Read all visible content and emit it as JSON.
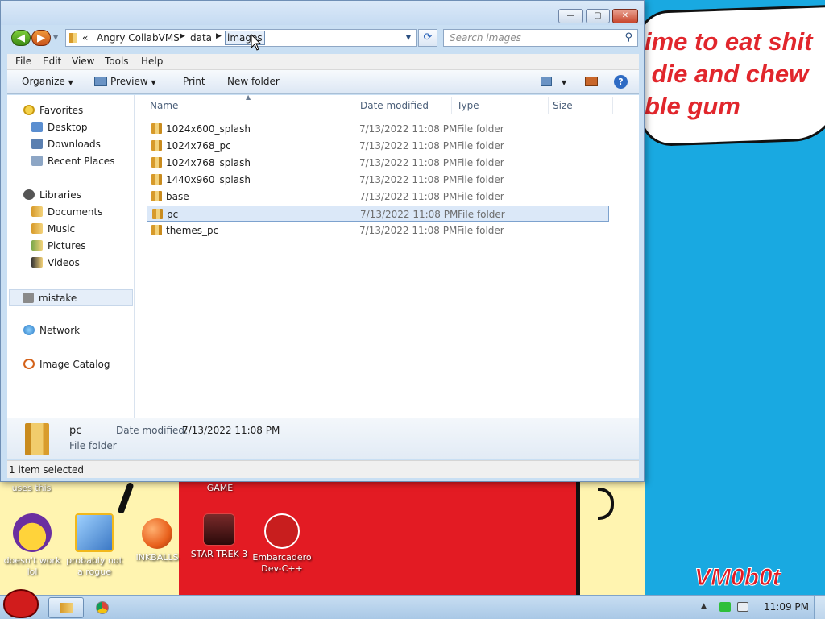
{
  "explorer": {
    "window_buttons": {
      "minimize": "—",
      "maximize": "▢",
      "close": "✕"
    },
    "breadcrumb": [
      "«",
      "Angry CollabVMS",
      "data",
      "images"
    ],
    "search_placeholder": "Search images",
    "menu": [
      "File",
      "Edit",
      "View",
      "Tools",
      "Help"
    ],
    "commands": {
      "organize": "Organize",
      "preview": "Preview",
      "print": "Print",
      "new_folder": "New folder"
    },
    "nav": {
      "favorites": "Favorites",
      "favorites_items": [
        "Desktop",
        "Downloads",
        "Recent Places"
      ],
      "libraries": "Libraries",
      "libraries_items": [
        "Documents",
        "Music",
        "Pictures",
        "Videos"
      ],
      "mistake": "mistake",
      "network": "Network",
      "image_catalog": "Image Catalog"
    },
    "columns": [
      "Name",
      "Date modified",
      "Type",
      "Size"
    ],
    "files": [
      {
        "name": "1024x600_splash",
        "date": "7/13/2022 11:08 PM",
        "type": "File folder"
      },
      {
        "name": "1024x768_pc",
        "date": "7/13/2022 11:08 PM",
        "type": "File folder"
      },
      {
        "name": "1024x768_splash",
        "date": "7/13/2022 11:08 PM",
        "type": "File folder"
      },
      {
        "name": "1440x960_splash",
        "date": "7/13/2022 11:08 PM",
        "type": "File folder"
      },
      {
        "name": "base",
        "date": "7/13/2022 11:08 PM",
        "type": "File folder"
      },
      {
        "name": "pc",
        "date": "7/13/2022 11:08 PM",
        "type": "File folder"
      },
      {
        "name": "themes_pc",
        "date": "7/13/2022 11:08 PM",
        "type": "File folder"
      }
    ],
    "selected_file": "pc",
    "details": {
      "name": "pc",
      "type": "File folder",
      "modified_label": "Date modified:",
      "modified": "7/13/2022 11:08 PM"
    },
    "status": "1 item selected"
  },
  "desktop": {
    "banner_text": "ime to eat shit\n die and chew\nble gum",
    "corner_tag": "VM0b0t",
    "top_labels": [
      "uses this",
      "GAME"
    ],
    "icons": [
      {
        "label": "doesn't work lol",
        "icon": "yahoo-messenger-icon",
        "color": "#6b2fa0"
      },
      {
        "label": "probably not a rogue",
        "icon": "gears-monitor-icon",
        "color": "#f2b81b"
      },
      {
        "label": "INKBALLS",
        "icon": "inkball-icon",
        "color": "#e8601c"
      },
      {
        "label": "STAR TREK 3",
        "icon": "star-wars-game-icon",
        "color": "#5a1e1e"
      },
      {
        "label": "Embarcadero Dev-C++",
        "icon": "devcpp-icon",
        "color": "#c81e1e"
      }
    ]
  },
  "taskbar": {
    "clock": "11:09 PM",
    "tray_arrow": "▲"
  }
}
